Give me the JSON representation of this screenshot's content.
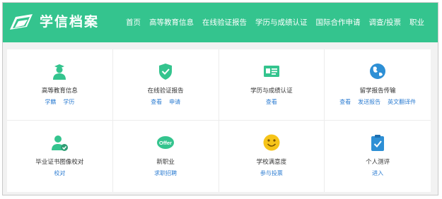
{
  "header": {
    "logo_text": "学信档案",
    "nav": [
      "首页",
      "高等教育信息",
      "在线验证报告",
      "学历与成绩认证",
      "国际合作申请",
      "调查/投票",
      "职业"
    ]
  },
  "cards": [
    {
      "title": "高等教育信息",
      "links": [
        "学籍",
        "学历"
      ],
      "icon": "graduate-icon"
    },
    {
      "title": "在线验证报告",
      "links": [
        "查看",
        "申请"
      ],
      "icon": "shield-check-icon"
    },
    {
      "title": "学历与成绩认证",
      "links": [
        "查看"
      ],
      "icon": "id-card-icon"
    },
    {
      "title": "留学报告传输",
      "links": [
        "查看",
        "发送报告",
        "英文翻译件"
      ],
      "icon": "globe-icon"
    },
    {
      "title": "毕业证书图像校对",
      "links": [
        "校对"
      ],
      "icon": "user-check-icon"
    },
    {
      "title": "新职业",
      "links": [
        "求职招聘"
      ],
      "icon": "offer-badge-icon"
    },
    {
      "title": "学校满意度",
      "links": [
        "参与投票"
      ],
      "icon": "smiley-icon"
    },
    {
      "title": "个人测评",
      "links": [
        "进入"
      ],
      "icon": "clipboard-check-icon"
    }
  ]
}
